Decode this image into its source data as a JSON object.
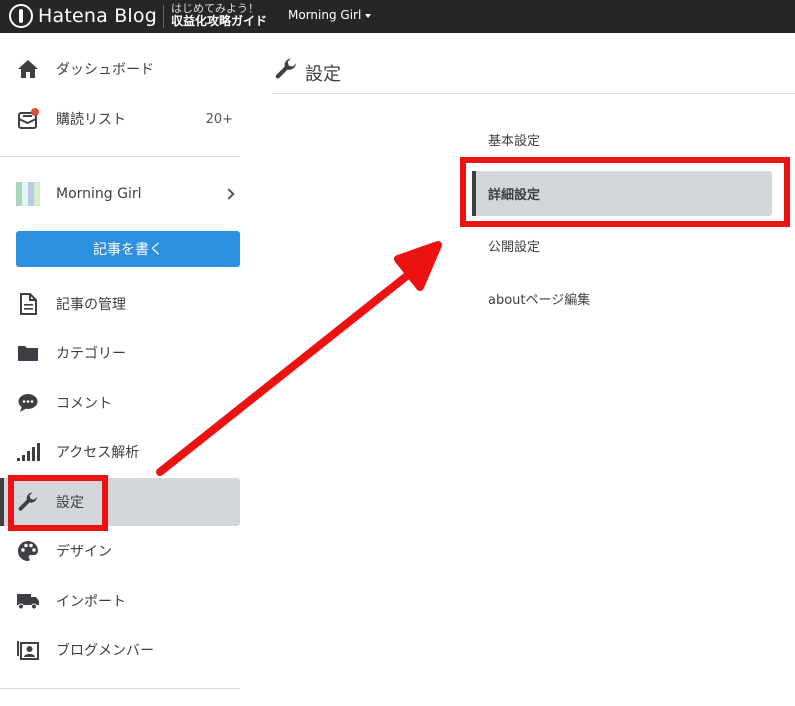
{
  "topbar": {
    "logo_text": "Hatena Blog",
    "promo_line1": "はじめてみよう！",
    "promo_line2": "収益化攻略ガイド",
    "blog_name": "Morning Girl"
  },
  "sidebar": {
    "dashboard": "ダッシュボード",
    "subscriptions": "購読リスト",
    "subscriptions_count": "20+",
    "blog_name": "Morning Girl",
    "write_button": "記事を書く",
    "manage_posts": "記事の管理",
    "categories": "カテゴリー",
    "comments": "コメント",
    "analytics": "アクセス解析",
    "settings": "設定",
    "design": "デザイン",
    "import": "インポート",
    "members": "ブログメンバー"
  },
  "main": {
    "title": "設定",
    "sub_items": [
      "基本設定",
      "詳細設定",
      "公開設定",
      "aboutページ編集"
    ]
  },
  "colors": {
    "accent_blue": "#2d8fe0",
    "highlight_red": "#ee1111",
    "active_bg": "#d3d6da",
    "topbar_bg": "#262626"
  }
}
